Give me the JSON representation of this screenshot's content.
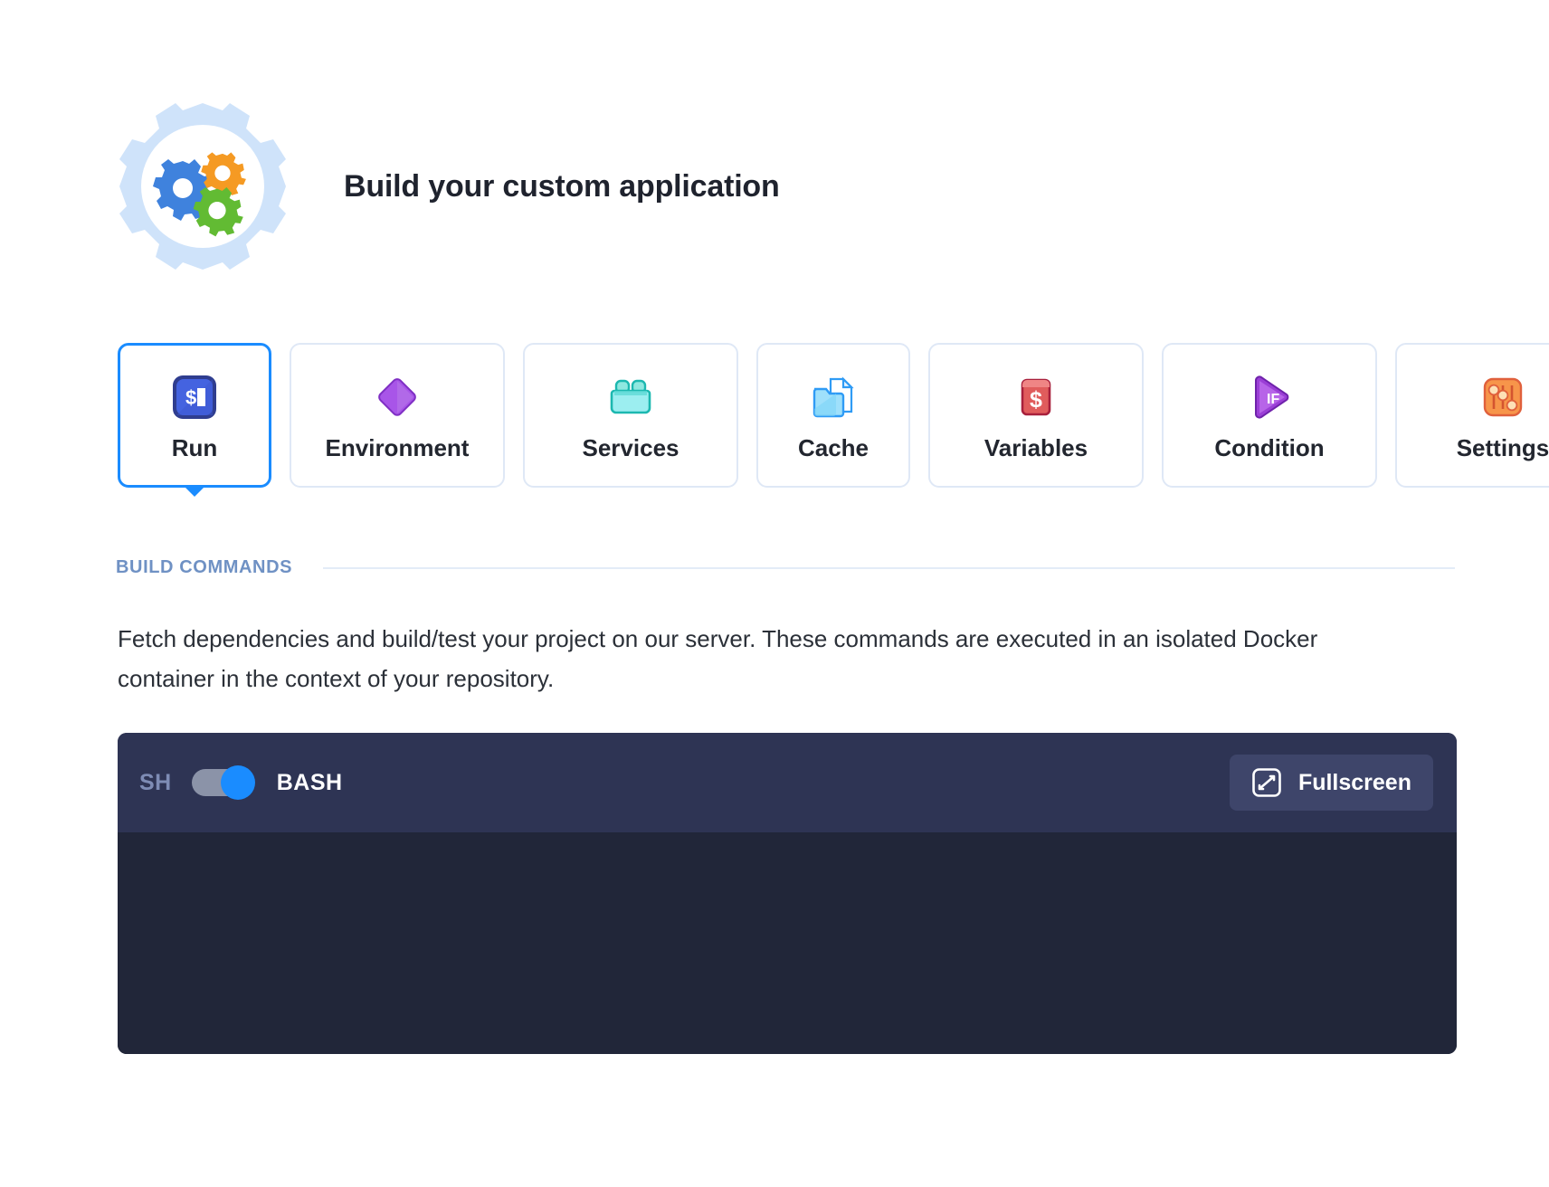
{
  "header": {
    "title": "Build your custom application",
    "icon": "gears-badge-icon"
  },
  "tabs": [
    {
      "label": "Run",
      "icon": "terminal-prompt-icon",
      "active": true
    },
    {
      "label": "Environment",
      "icon": "purple-diamond-icon",
      "active": false
    },
    {
      "label": "Services",
      "icon": "services-crate-icon",
      "active": false
    },
    {
      "label": "Cache",
      "icon": "folder-document-icon",
      "active": false
    },
    {
      "label": "Variables",
      "icon": "dollar-box-icon",
      "active": false
    },
    {
      "label": "Condition",
      "icon": "if-triangle-icon",
      "active": false
    },
    {
      "label": "Settings",
      "icon": "sliders-icon",
      "active": false
    }
  ],
  "section": {
    "title": "BUILD COMMANDS"
  },
  "description": "Fetch dependencies and build/test your project on our server. These commands are executed in an isolated Docker container in the context of your repository.",
  "terminal": {
    "shell_off_label": "SH",
    "shell_on_label": "BASH",
    "toggle_state": "BASH",
    "fullscreen_label": "Fullscreen",
    "content": ""
  },
  "colors": {
    "accent": "#1a8cff",
    "tab_border": "#dfe8f6",
    "section_title": "#6f91c4",
    "terminal_header": "#2e3454",
    "terminal_body": "#212639",
    "fullscreen_button": "#3e456a"
  }
}
